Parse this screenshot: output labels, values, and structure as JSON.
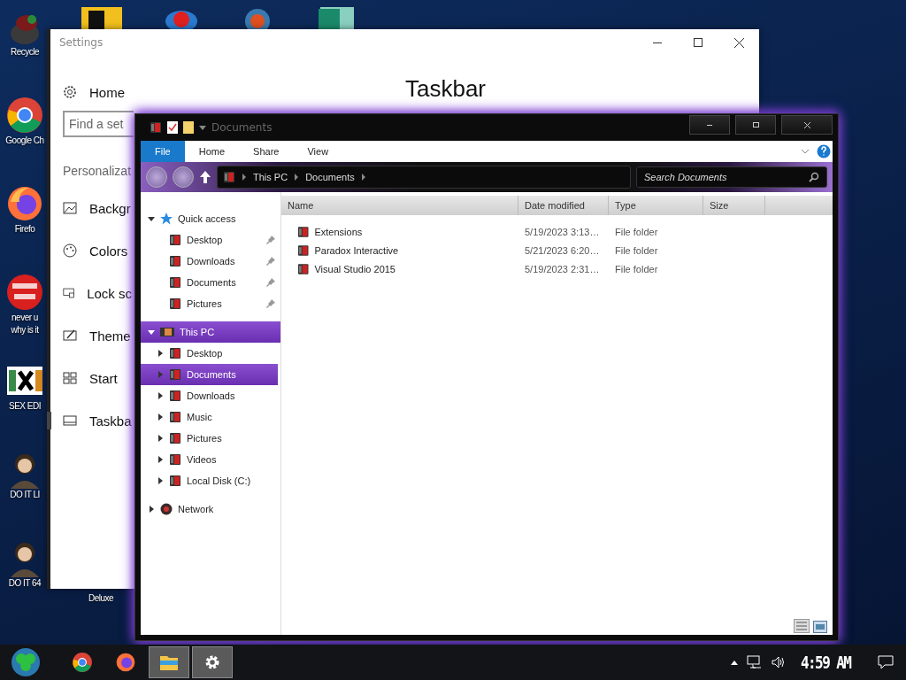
{
  "desktop": {
    "icons": [
      {
        "kind": "recycle",
        "lines": [
          "Recycle"
        ]
      },
      {
        "kind": "chrome",
        "lines": [
          "Google Ch"
        ]
      },
      {
        "kind": "firefox",
        "lines": [
          "Firefo"
        ]
      },
      {
        "kind": "dev",
        "lines": [
          "never u",
          "why is it"
        ]
      },
      {
        "kind": "hex",
        "lines": [
          "SEX EDI"
        ]
      },
      {
        "kind": "figure",
        "lines": [
          "DO IT LI"
        ]
      },
      {
        "kind": "figure",
        "lines": [
          "DO IT 64"
        ]
      }
    ],
    "hidden_label": "Deluxe"
  },
  "settings_window": {
    "title": "Settings",
    "home": "Home",
    "search": {
      "placeholder": "Find a set"
    },
    "section": "Personalizat",
    "heading": "Taskbar",
    "nav": [
      {
        "label": "Backgr",
        "selected": false
      },
      {
        "label": "Colors",
        "selected": false
      },
      {
        "label": "Lock sc",
        "selected": false
      },
      {
        "label": "Theme",
        "selected": false
      },
      {
        "label": "Start",
        "selected": false
      },
      {
        "label": "Taskba",
        "selected": true
      }
    ]
  },
  "explorer": {
    "title": "Documents",
    "ribbon_tabs": [
      {
        "label": "File",
        "selected": true
      },
      {
        "label": "Home",
        "selected": false
      },
      {
        "label": "Share",
        "selected": false
      },
      {
        "label": "View",
        "selected": false
      }
    ],
    "breadcrumb": [
      "This PC",
      "Documents"
    ],
    "search": {
      "placeholder": "Search Documents"
    },
    "nav": [
      {
        "label": "Quick access",
        "kind": "star",
        "expanded": true,
        "selected": false,
        "children": [
          {
            "label": "Desktop",
            "pinned": true,
            "selected": false
          },
          {
            "label": "Downloads",
            "pinned": true,
            "selected": false
          },
          {
            "label": "Documents",
            "pinned": true,
            "selected": false
          },
          {
            "label": "Pictures",
            "pinned": true,
            "selected": false
          }
        ]
      },
      {
        "label": "This PC",
        "kind": "pc",
        "expanded": true,
        "selected": true,
        "children": [
          {
            "label": "Desktop",
            "pinned": false,
            "selected": false
          },
          {
            "label": "Documents",
            "pinned": false,
            "selected": true
          },
          {
            "label": "Downloads",
            "pinned": false,
            "selected": false
          },
          {
            "label": "Music",
            "pinned": false,
            "selected": false
          },
          {
            "label": "Pictures",
            "pinned": false,
            "selected": false
          },
          {
            "label": "Videos",
            "pinned": false,
            "selected": false
          },
          {
            "label": "Local Disk (C:)",
            "pinned": false,
            "selected": false
          }
        ]
      },
      {
        "label": "Network",
        "kind": "network",
        "expanded": false,
        "selected": false
      }
    ],
    "columns": [
      "Name",
      "Date modified",
      "Type",
      "Size"
    ],
    "rows": [
      {
        "name": "Extensions",
        "date": "5/19/2023 3:13…",
        "type": "File folder"
      },
      {
        "name": "Paradox Interactive",
        "date": "5/21/2023 6:20…",
        "type": "File folder"
      },
      {
        "name": "Visual Studio 2015",
        "date": "5/19/2023 2:31…",
        "type": "File folder"
      }
    ]
  },
  "taskbar": {
    "apps": [
      {
        "kind": "start",
        "active": false
      },
      {
        "kind": "chrome",
        "active": false
      },
      {
        "kind": "firefox",
        "active": false
      },
      {
        "kind": "explorer",
        "active": true
      },
      {
        "kind": "settings",
        "active": true
      }
    ],
    "clock": "4:59 AM"
  }
}
